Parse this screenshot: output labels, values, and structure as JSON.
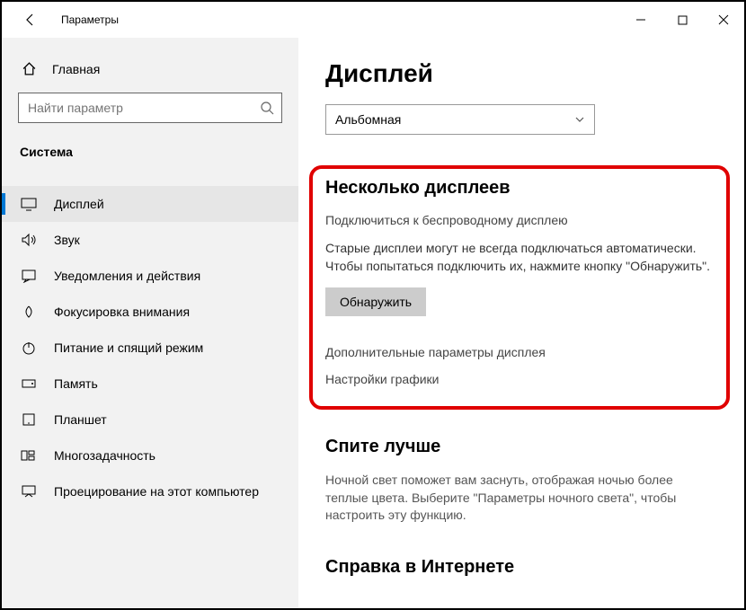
{
  "titlebar": {
    "title": "Параметры"
  },
  "sidebar": {
    "home": "Главная",
    "searchPlaceholder": "Найти параметр",
    "category": "Система",
    "items": [
      {
        "label": "Дисплей"
      },
      {
        "label": "Звук"
      },
      {
        "label": "Уведомления и действия"
      },
      {
        "label": "Фокусировка внимания"
      },
      {
        "label": "Питание и спящий режим"
      },
      {
        "label": "Память"
      },
      {
        "label": "Планшет"
      },
      {
        "label": "Многозадачность"
      },
      {
        "label": "Проецирование на этот компьютер"
      }
    ]
  },
  "main": {
    "title": "Дисплей",
    "orientation": "Альбомная",
    "multi": {
      "heading": "Несколько дисплеев",
      "wirelessLink": "Подключиться к беспроводному дисплею",
      "oldText": "Старые дисплеи могут не всегда подключаться автоматически. Чтобы попытаться подключить их, нажмите кнопку \"Обнаружить\".",
      "detect": "Обнаружить",
      "advancedLink": "Дополнительные параметры дисплея",
      "graphicsLink": "Настройки графики"
    },
    "sleep": {
      "heading": "Спите лучше",
      "text": "Ночной свет поможет вам заснуть, отображая ночью более теплые цвета. Выберите \"Параметры ночного света\", чтобы настроить эту функцию."
    },
    "help": {
      "heading": "Справка в Интернете"
    }
  }
}
